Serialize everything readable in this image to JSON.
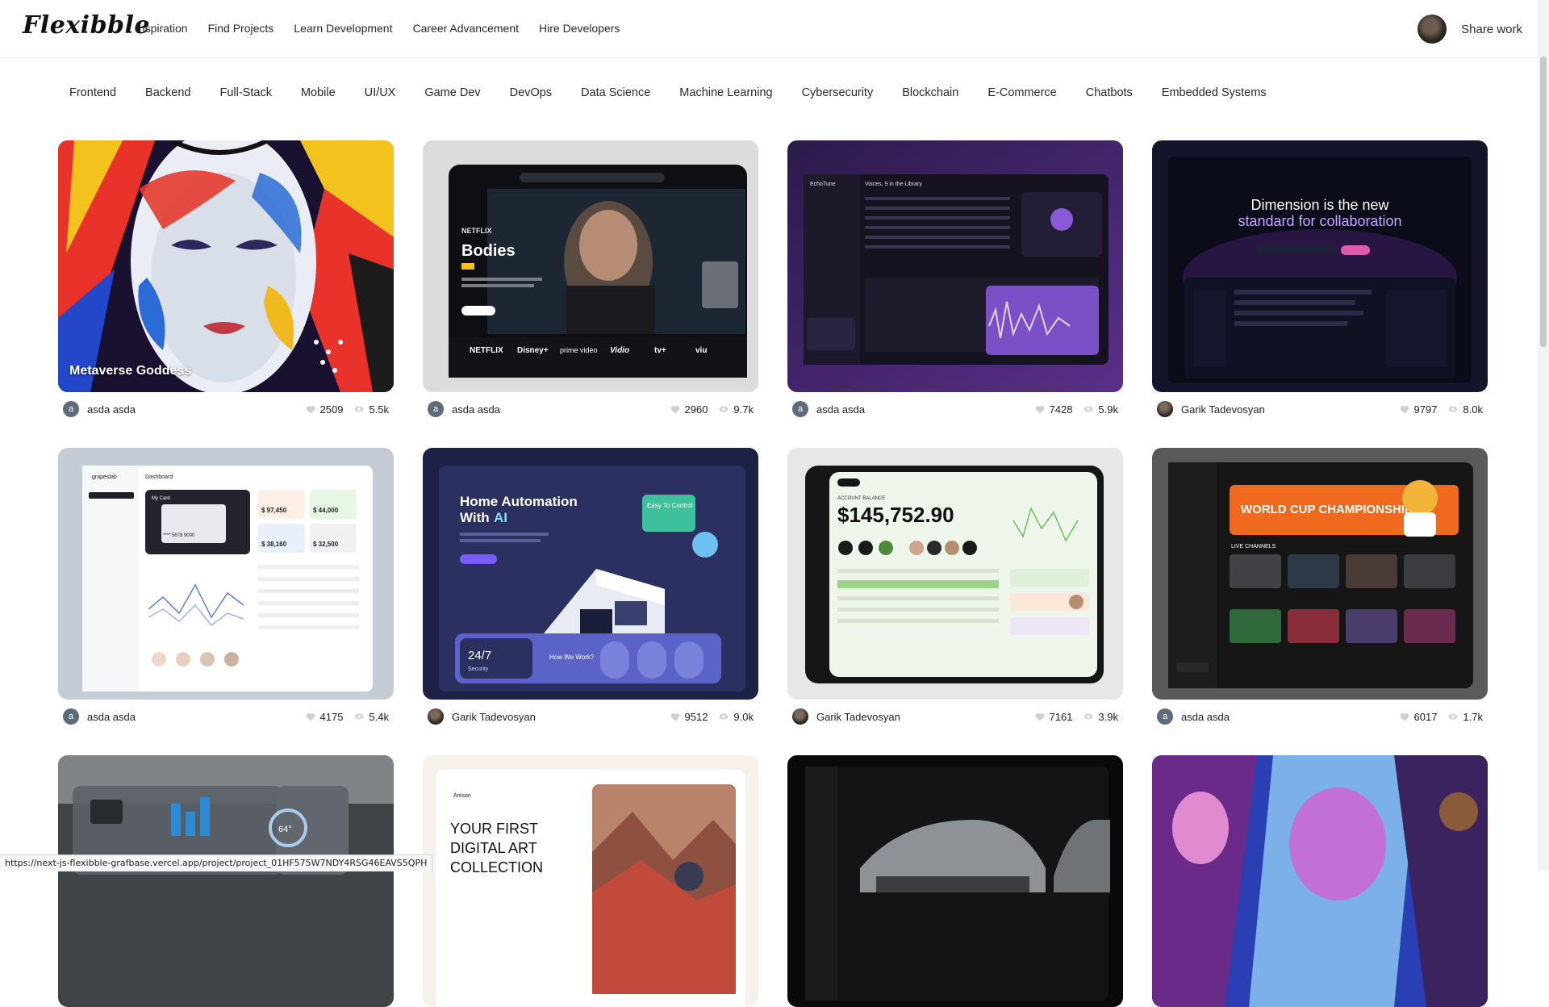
{
  "brand": {
    "logo_text": "Flexibble"
  },
  "nav": {
    "links": [
      "Inspiration",
      "Find Projects",
      "Learn Development",
      "Career Advancement",
      "Hire Developers"
    ],
    "share_label": "Share work"
  },
  "categories": [
    "Frontend",
    "Backend",
    "Full-Stack",
    "Mobile",
    "UI/UX",
    "Game Dev",
    "DevOps",
    "Data Science",
    "Machine Learning",
    "Cybersecurity",
    "Blockchain",
    "E-Commerce",
    "Chatbots",
    "Embedded Systems"
  ],
  "projects": [
    {
      "title": "Metaverse Goddess",
      "author": "asda asda",
      "avatar": "a",
      "likes": "2509",
      "views": "5.5k"
    },
    {
      "title": "",
      "author": "asda asda",
      "avatar": "a",
      "likes": "2960",
      "views": "9.7k",
      "text": {
        "brand": "NETFLIX",
        "headline": "Bodies",
        "services": [
          "NETFLIX",
          "Disney+",
          "prime video",
          "Vidio",
          "tv+",
          "viu"
        ]
      }
    },
    {
      "title": "",
      "author": "asda asda",
      "avatar": "a",
      "likes": "7428",
      "views": "5.9k",
      "text": {
        "app": "EchoTune",
        "heading": "Voices, 9 in the Library"
      }
    },
    {
      "title": "",
      "author": "Garik Tadevosyan",
      "avatar": "",
      "likes": "9797",
      "views": "8.0k",
      "text": {
        "line1": "Dimension is the new",
        "line2": "standard for collaboration"
      }
    },
    {
      "title": "",
      "author": "asda asda",
      "avatar": "a",
      "likes": "4175",
      "views": "5.4k",
      "text": {
        "app": "grapeslab",
        "section": "Dashboard",
        "card": "My Card",
        "balance": "$ 97,450",
        "spending": "$ 44,000",
        "investment": "$ 38,160",
        "profit": "$ 32,500",
        "card_number": "**** 5678 9000"
      }
    },
    {
      "title": "",
      "author": "Garik Tadevosyan",
      "avatar": "",
      "likes": "9512",
      "views": "9.0k",
      "text": {
        "headline1": "Home Automation",
        "headline2": "With",
        "accent": "AI",
        "badge": "Easy To Control",
        "security": "24/7",
        "security_sub": "Security",
        "how": "How We Work?"
      }
    },
    {
      "title": "",
      "author": "Garik Tadevosyan",
      "avatar": "",
      "likes": "7161",
      "views": "3.9k",
      "text": {
        "label": "ACCOUNT BALANCE",
        "amount": "$145,752.90"
      }
    },
    {
      "title": "",
      "author": "asda asda",
      "avatar": "a",
      "likes": "6017",
      "views": "1.7k",
      "text": {
        "banner": "WORLD CUP CHAMPIONSHIP",
        "section": "LIVE CHANNELS"
      }
    },
    {
      "title": "",
      "author": "",
      "avatar": "",
      "likes": "",
      "views": "",
      "text": {
        "temp": "64°"
      }
    },
    {
      "title": "",
      "author": "",
      "avatar": "",
      "likes": "",
      "views": "",
      "text": {
        "line1": "YOUR FIRST",
        "line2": "DIGITAL ART",
        "line3": "COLLECTION",
        "brand": "Artisan"
      }
    },
    {
      "title": "",
      "author": "",
      "avatar": "",
      "likes": "",
      "views": ""
    },
    {
      "title": "",
      "author": "",
      "avatar": "",
      "likes": "",
      "views": ""
    }
  ],
  "status_url": "https://next-js-flexibble-grafbase.vercel.app/project/project_01HF575W7NDY4RSG46EAVS5QPH"
}
